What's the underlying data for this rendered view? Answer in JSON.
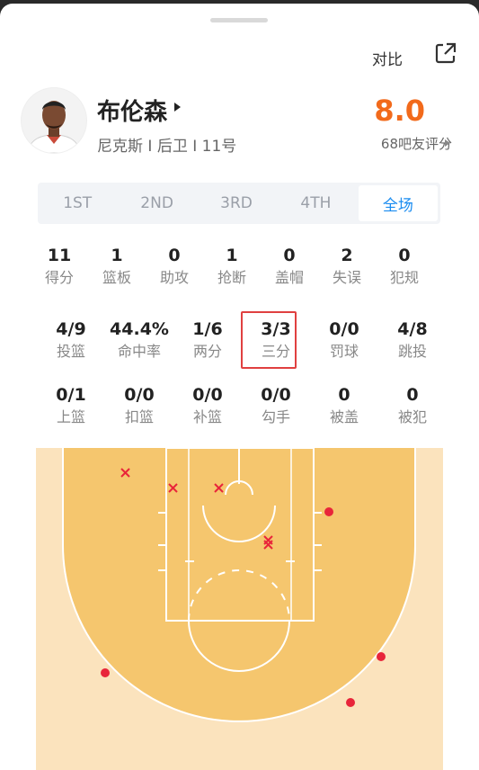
{
  "header": {
    "compare_label": "对比",
    "share_icon": "share-icon"
  },
  "player": {
    "name": "布伦森",
    "info": "尼克斯 I 后卫 I 11号",
    "rating": "8.0",
    "rating_count": "68吧友评分"
  },
  "tabs": [
    {
      "label": "1ST",
      "active": false
    },
    {
      "label": "2ND",
      "active": false
    },
    {
      "label": "3RD",
      "active": false
    },
    {
      "label": "4TH",
      "active": false
    },
    {
      "label": "全场",
      "active": true
    }
  ],
  "stats_row1": [
    {
      "value": "11",
      "label": "得分"
    },
    {
      "value": "1",
      "label": "篮板"
    },
    {
      "value": "0",
      "label": "助攻"
    },
    {
      "value": "1",
      "label": "抢断"
    },
    {
      "value": "0",
      "label": "盖帽"
    },
    {
      "value": "2",
      "label": "失误"
    },
    {
      "value": "0",
      "label": "犯规"
    }
  ],
  "stats_row2": [
    {
      "value": "4/9",
      "label": "投篮"
    },
    {
      "value": "44.4%",
      "label": "命中率"
    },
    {
      "value": "1/6",
      "label": "两分"
    },
    {
      "value": "3/3",
      "label": "三分"
    },
    {
      "value": "0/0",
      "label": "罚球"
    },
    {
      "value": "4/8",
      "label": "跳投"
    }
  ],
  "stats_row3": [
    {
      "value": "0/1",
      "label": "上篮"
    },
    {
      "value": "0/0",
      "label": "扣篮"
    },
    {
      "value": "0/0",
      "label": "补篮"
    },
    {
      "value": "0/0",
      "label": "勾手"
    },
    {
      "value": "0",
      "label": "被盖"
    },
    {
      "value": "0",
      "label": "被犯"
    }
  ],
  "colors": {
    "accent": "#1a8cf0",
    "rating": "#f26a1b",
    "made": "#e8253a",
    "missed": "#e8253a",
    "court_paint": "#f5c66e",
    "court_outer": "#fbe3bd"
  }
}
